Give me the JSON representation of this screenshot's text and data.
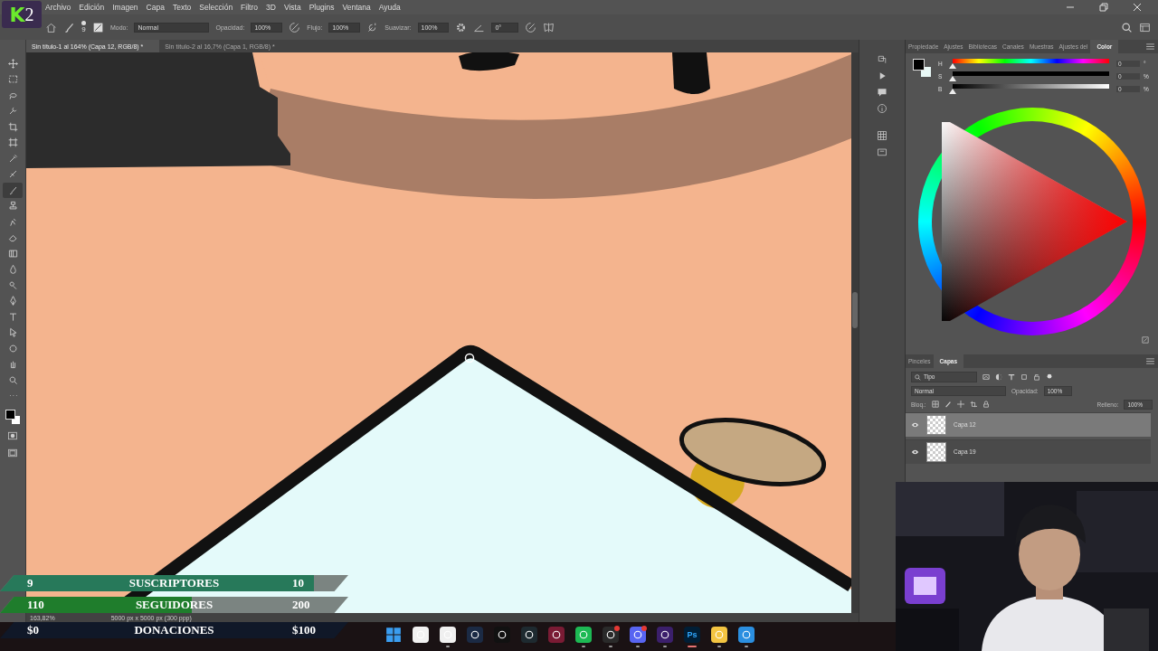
{
  "logo": {
    "letter": "K",
    "number": "2"
  },
  "menu": [
    "Archivo",
    "Edición",
    "Imagen",
    "Capa",
    "Texto",
    "Selección",
    "Filtro",
    "3D",
    "Vista",
    "Plugins",
    "Ventana",
    "Ayuda"
  ],
  "options_bar": {
    "brush_size": "9",
    "mode_label": "Modo:",
    "mode": "Normal",
    "opacity_label": "Opacidad:",
    "opacity": "100%",
    "flow_label": "Flujo:",
    "flow": "100%",
    "smoothing_label": "Suavizar:",
    "smoothing": "100%",
    "angle": "0°"
  },
  "documents": [
    {
      "title": "Sin título-1 al 164% (Capa 12, RGB/8) *",
      "selected": true
    },
    {
      "title": "Sin título-2 al 16,7% (Capa 1, RGB/8) *",
      "selected": false
    }
  ],
  "tools": [
    {
      "kind": "move",
      "selected": false
    },
    {
      "kind": "marquee",
      "selected": false
    },
    {
      "kind": "lasso",
      "selected": false
    },
    {
      "kind": "quick",
      "selected": false
    },
    {
      "kind": "crop",
      "selected": false
    },
    {
      "kind": "frame",
      "selected": false
    },
    {
      "kind": "eyedropper",
      "selected": false
    },
    {
      "kind": "healing",
      "selected": false
    },
    {
      "kind": "brush",
      "selected": true
    },
    {
      "kind": "stamp",
      "selected": false
    },
    {
      "kind": "history",
      "selected": false
    },
    {
      "kind": "eraser",
      "selected": false
    },
    {
      "kind": "gradient",
      "selected": false
    },
    {
      "kind": "blur",
      "selected": false
    },
    {
      "kind": "dodge",
      "selected": false
    },
    {
      "kind": "pen",
      "selected": false
    },
    {
      "kind": "type",
      "selected": false
    },
    {
      "kind": "select",
      "selected": false
    },
    {
      "kind": "shape",
      "selected": false
    },
    {
      "kind": "hand",
      "selected": false
    },
    {
      "kind": "zoom",
      "selected": false
    },
    {
      "kind": "more",
      "selected": false
    }
  ],
  "color_panel": {
    "tabs": [
      {
        "label": "Propiedade",
        "selected": false
      },
      {
        "label": "Ajustes",
        "selected": false
      },
      {
        "label": "Bibliotecas",
        "selected": false
      },
      {
        "label": "Canales",
        "selected": false
      },
      {
        "label": "Muestras",
        "selected": false
      },
      {
        "label": "Ajustes del",
        "selected": false
      },
      {
        "label": "Color",
        "selected": true
      }
    ],
    "sliders": [
      {
        "label": "H",
        "kind": "hue",
        "level": 0,
        "value": "0",
        "unit": "°"
      },
      {
        "label": "S",
        "kind": "saturation",
        "level": 0,
        "value": "0",
        "unit": "%"
      },
      {
        "label": "B",
        "kind": "brightness",
        "level": 0,
        "value": "0",
        "unit": "%"
      }
    ]
  },
  "layers_panel": {
    "tabs": [
      {
        "label": "Pinceles",
        "selected": false
      },
      {
        "label": "Capas",
        "selected": true
      }
    ],
    "filter": "Tipo",
    "blend_mode": "Normal",
    "opacity_label": "Opacidad:",
    "opacity": "100%",
    "lock_label": "Bloq.:",
    "fill_label": "Relleno:",
    "fill": "100%",
    "layers": [
      {
        "name": "Capa 12",
        "selected": true,
        "visible": true
      },
      {
        "name": "Capa 19",
        "selected": false,
        "visible": true
      }
    ]
  },
  "status_bar": {
    "zoom": "163,82%",
    "size": "5000 px x 5000 px (300 ppp)"
  },
  "stream_goals": [
    {
      "current": "9",
      "label": "SUSCRIPTORES",
      "goal": "10",
      "level": 0.9,
      "color": "#27795a"
    },
    {
      "current": "110",
      "label": "SEGUIDORES",
      "goal": "200",
      "level": 0.55,
      "color": "#1f7d2c"
    },
    {
      "current": "$0",
      "label": "DONACIONES",
      "goal": "$100",
      "level": 0,
      "color": "#101828"
    }
  ],
  "taskbar": [
    {
      "kind": "start",
      "active": false,
      "notification": false
    },
    {
      "kind": "snip",
      "active": false,
      "notification": false
    },
    {
      "kind": "store",
      "active": true,
      "notification": false
    },
    {
      "kind": "steam",
      "active": false,
      "notification": false
    },
    {
      "kind": "tiktok",
      "active": false,
      "notification": false
    },
    {
      "kind": "league",
      "active": false,
      "notification": false
    },
    {
      "kind": "vivaldi",
      "active": false,
      "notification": false
    },
    {
      "kind": "spotify",
      "active": true,
      "notification": false
    },
    {
      "kind": "obs",
      "active": true,
      "notification": true
    },
    {
      "kind": "discord",
      "active": true,
      "notification": true
    },
    {
      "kind": "purple",
      "active": true,
      "notification": false
    },
    {
      "kind": "photoshop",
      "label": "Ps",
      "active": true,
      "notification": false
    },
    {
      "kind": "folder",
      "active": true,
      "notification": false
    },
    {
      "kind": "photos",
      "active": true,
      "notification": false
    }
  ]
}
